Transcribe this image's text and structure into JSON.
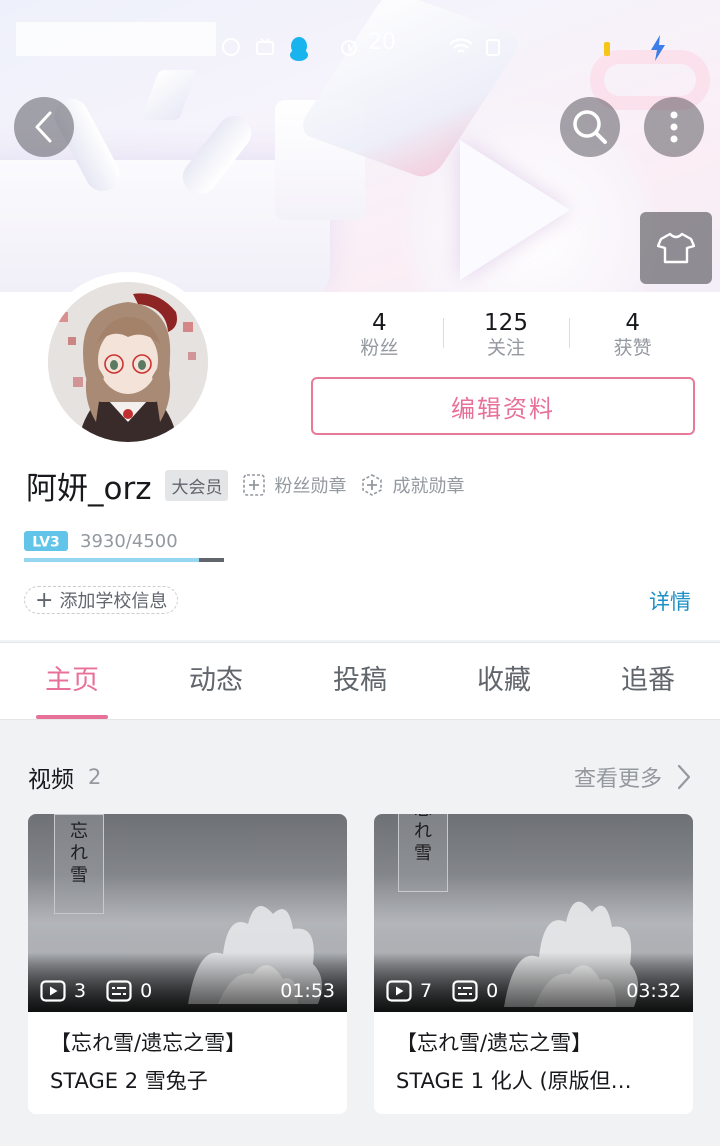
{
  "status_bar": {
    "time": "20"
  },
  "profile": {
    "username": "阿妍_orz",
    "vip_badge": "大会员",
    "fan_medal": "粉丝勋章",
    "achievement_medal": "成就勋章",
    "edit_button": "编辑资料",
    "stats": [
      {
        "value": "4",
        "label": "粉丝"
      },
      {
        "value": "125",
        "label": "关注"
      },
      {
        "value": "4",
        "label": "获赞"
      }
    ],
    "level": {
      "badge": "LV3",
      "exp": "3930/4500",
      "progress": 0.873
    },
    "school_label": "添加学校信息",
    "details_link": "详情"
  },
  "tabs": [
    {
      "label": "主页",
      "active": true
    },
    {
      "label": "动态",
      "active": false
    },
    {
      "label": "投稿",
      "active": false
    },
    {
      "label": "收藏",
      "active": false
    },
    {
      "label": "追番",
      "active": false
    }
  ],
  "videos": {
    "title": "视频",
    "count": "2",
    "more_label": "查看更多",
    "items": [
      {
        "plays": "3",
        "danmaku": "0",
        "duration": "01:53",
        "title_line1": "【忘れ雪/遗忘之雪】",
        "title_line2": "STAGE 2 雪兔子",
        "sign": [
          "忘",
          "れ",
          "雪"
        ]
      },
      {
        "plays": "7",
        "danmaku": "0",
        "duration": "03:32",
        "title_line1": "【忘れ雪/遗忘之雪】",
        "title_line2": "STAGE 1 化人 (原版但…",
        "sign": [
          "忘",
          "れ",
          "雪"
        ]
      }
    ]
  },
  "colors": {
    "accent_pink": "#e8719a",
    "link_blue": "#1b8fc6",
    "level_blue": "#97d6f0"
  },
  "icons": [
    "back-icon",
    "search-icon",
    "more-vertical-icon",
    "tshirt-icon",
    "play-icon",
    "danmaku-icon",
    "chevron-right-icon",
    "add-icon"
  ]
}
